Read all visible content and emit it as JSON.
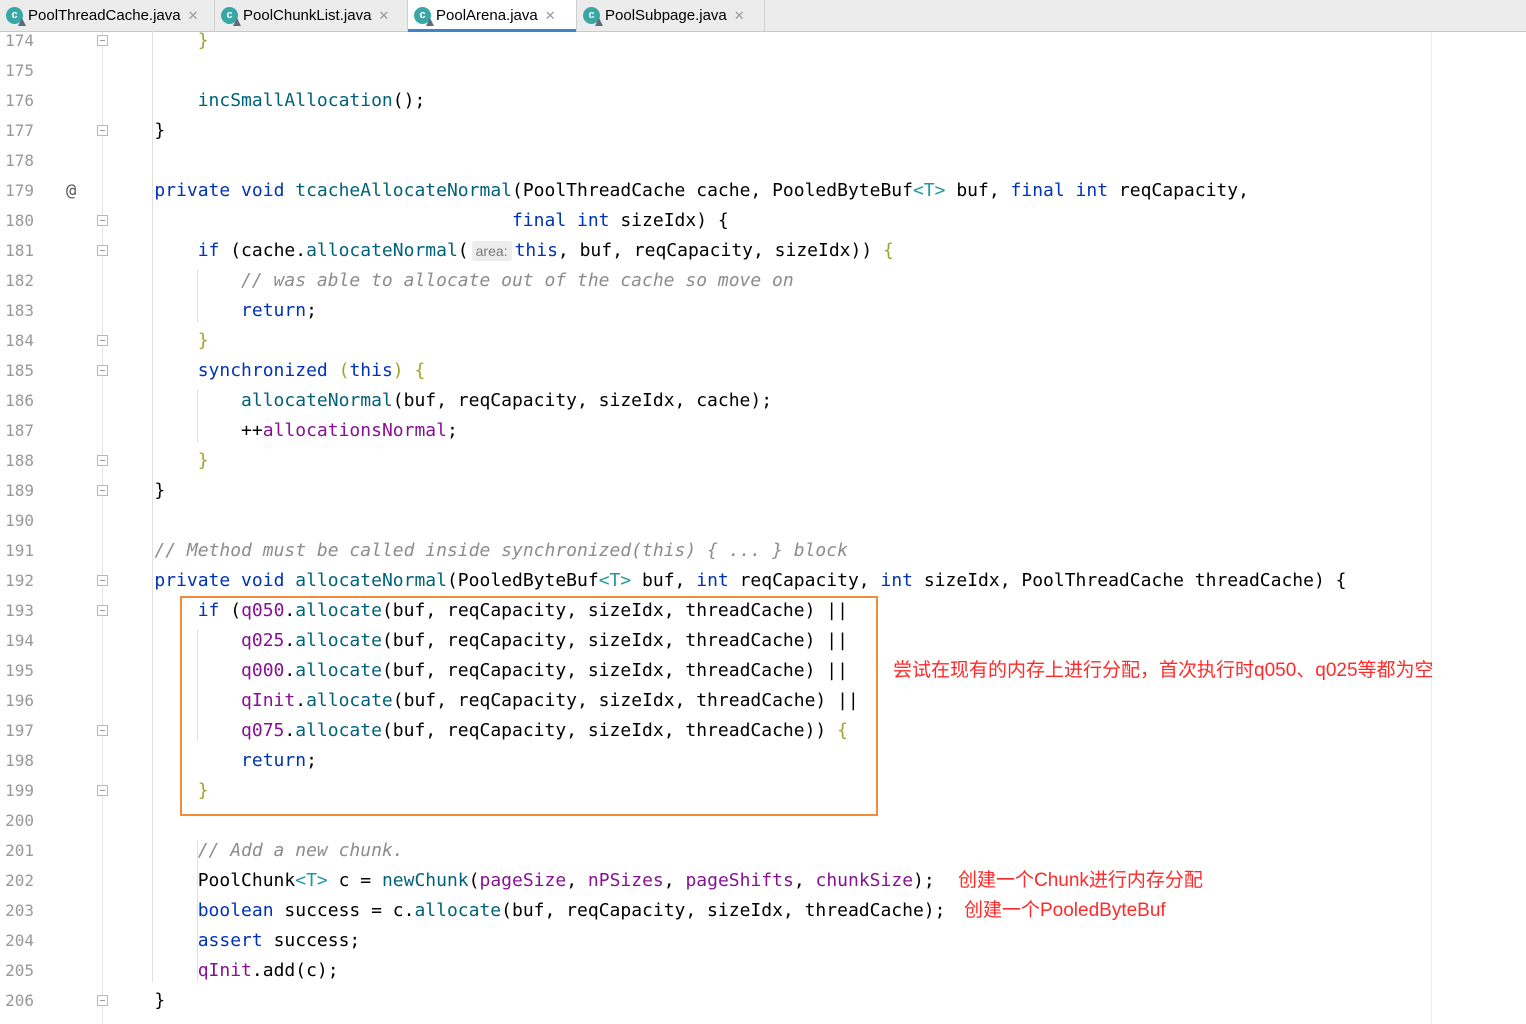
{
  "tabs": [
    {
      "label": "PoolThreadCache.java",
      "icon": "java-class-icon",
      "icon_letter": "c",
      "active": false
    },
    {
      "label": "PoolChunkList.java",
      "icon": "java-class-icon",
      "icon_letter": "c",
      "active": false
    },
    {
      "label": "PoolArena.java",
      "icon": "java-class-icon",
      "icon_letter": "c",
      "active": true
    },
    {
      "label": "PoolSubpage.java",
      "icon": "java-class-icon",
      "icon_letter": "c",
      "active": false
    }
  ],
  "tab_close_glyph": "✕",
  "colors": {
    "keyword": "#0033b3",
    "method": "#00627a",
    "field": "#871094",
    "comment": "#8c8c8c",
    "generic": "#20999d",
    "highlight_box": "#f08c3a",
    "annotation": "#ff2a2a",
    "active_tab_underline": "#4083c9"
  },
  "gutter_marker": {
    "line": "179",
    "glyph": "@"
  },
  "lines": [
    {
      "n": "174",
      "fold": "end",
      "indent": 2,
      "t": [
        [
          "}",
          "br1"
        ]
      ]
    },
    {
      "n": "175",
      "t": []
    },
    {
      "n": "176",
      "indent": 2,
      "t": [
        [
          "incSmallAllocation",
          "fn"
        ],
        [
          "();",
          ""
        ]
      ]
    },
    {
      "n": "177",
      "fold": "end",
      "indent": 1,
      "t": [
        [
          "}",
          ""
        ]
      ]
    },
    {
      "n": "178",
      "t": []
    },
    {
      "n": "179",
      "indent": 1,
      "t": [
        [
          "private void ",
          "kw"
        ],
        [
          "tcacheAllocateNormal",
          "fn"
        ],
        [
          "(PoolThreadCache cache, PooledByteBuf",
          ""
        ],
        [
          "<T>",
          "gen"
        ],
        [
          " buf, ",
          ""
        ],
        [
          "final int ",
          "kw"
        ],
        [
          "reqCapacity,",
          ""
        ]
      ]
    },
    {
      "n": "180",
      "fold": "start",
      "t": [
        [
          "                                     ",
          ""
        ],
        [
          "final int ",
          "kw"
        ],
        [
          "sizeIdx) {",
          ""
        ]
      ]
    },
    {
      "n": "181",
      "fold": "start",
      "indent": 2,
      "t": [
        [
          "if ",
          "kw"
        ],
        [
          "(cache.",
          ""
        ],
        [
          "allocateNormal",
          "fn"
        ],
        [
          "(",
          ""
        ],
        [
          "area:",
          "hint"
        ],
        [
          "this",
          "kw"
        ],
        [
          ", buf, reqCapacity, sizeIdx)) ",
          ""
        ],
        [
          "{",
          "br1"
        ]
      ]
    },
    {
      "n": "182",
      "indent": 3,
      "t": [
        [
          "// was able to allocate out of the cache so move on",
          "cm"
        ]
      ]
    },
    {
      "n": "183",
      "indent": 3,
      "t": [
        [
          "return",
          "kw"
        ],
        [
          ";",
          ""
        ]
      ]
    },
    {
      "n": "184",
      "fold": "end",
      "indent": 2,
      "t": [
        [
          "}",
          "br1"
        ]
      ]
    },
    {
      "n": "185",
      "fold": "start",
      "indent": 2,
      "t": [
        [
          "synchronized ",
          "kw"
        ],
        [
          "(",
          "br1"
        ],
        [
          "this",
          "kw"
        ],
        [
          ") ",
          "br1"
        ],
        [
          "{",
          "br1"
        ]
      ]
    },
    {
      "n": "186",
      "indent": 3,
      "t": [
        [
          "allocateNormal",
          "fn"
        ],
        [
          "(buf, reqCapacity, sizeIdx, cache);",
          ""
        ]
      ]
    },
    {
      "n": "187",
      "indent": 3,
      "t": [
        [
          "++",
          ""
        ],
        [
          "allocationsNormal",
          "fld"
        ],
        [
          ";",
          ""
        ]
      ]
    },
    {
      "n": "188",
      "fold": "end",
      "indent": 2,
      "t": [
        [
          "}",
          "br1"
        ]
      ]
    },
    {
      "n": "189",
      "fold": "end",
      "indent": 1,
      "t": [
        [
          "}",
          ""
        ]
      ]
    },
    {
      "n": "190",
      "t": []
    },
    {
      "n": "191",
      "indent": 1,
      "t": [
        [
          "// Method must be called inside synchronized(this) { ... } block",
          "cm"
        ]
      ]
    },
    {
      "n": "192",
      "fold": "start",
      "indent": 1,
      "t": [
        [
          "private void ",
          "kw"
        ],
        [
          "allocateNormal",
          "fn"
        ],
        [
          "(PooledByteBuf",
          ""
        ],
        [
          "<T>",
          "gen"
        ],
        [
          " buf, ",
          ""
        ],
        [
          "int ",
          "kw"
        ],
        [
          "reqCapacity, ",
          ""
        ],
        [
          "int ",
          "kw"
        ],
        [
          "sizeIdx, PoolThreadCache threadCache) {",
          ""
        ]
      ]
    },
    {
      "n": "193",
      "fold": "start",
      "indent": 2,
      "t": [
        [
          "if ",
          "kw"
        ],
        [
          "(",
          ""
        ],
        [
          "q050",
          "fld"
        ],
        [
          ".",
          ""
        ],
        [
          "allocate",
          "fn"
        ],
        [
          "(buf, reqCapacity, sizeIdx, threadCache) ||",
          ""
        ]
      ]
    },
    {
      "n": "194",
      "indent": 3,
      "t": [
        [
          "q025",
          "fld"
        ],
        [
          ".",
          ""
        ],
        [
          "allocate",
          "fn"
        ],
        [
          "(buf, reqCapacity, sizeIdx, threadCache) ||",
          ""
        ]
      ]
    },
    {
      "n": "195",
      "indent": 3,
      "t": [
        [
          "q000",
          "fld"
        ],
        [
          ".",
          ""
        ],
        [
          "allocate",
          "fn"
        ],
        [
          "(buf, reqCapacity, sizeIdx, threadCache) ||",
          ""
        ]
      ]
    },
    {
      "n": "196",
      "indent": 3,
      "t": [
        [
          "qInit",
          "fld"
        ],
        [
          ".",
          ""
        ],
        [
          "allocate",
          "fn"
        ],
        [
          "(buf, reqCapacity, sizeIdx, threadCache) ||",
          ""
        ]
      ]
    },
    {
      "n": "197",
      "fold": "start",
      "indent": 3,
      "t": [
        [
          "q075",
          "fld"
        ],
        [
          ".",
          ""
        ],
        [
          "allocate",
          "fn"
        ],
        [
          "(buf, reqCapacity, sizeIdx, threadCache)) ",
          ""
        ],
        [
          "{",
          "br1"
        ]
      ]
    },
    {
      "n": "198",
      "indent": 3,
      "t": [
        [
          "return",
          "kw"
        ],
        [
          ";",
          ""
        ]
      ]
    },
    {
      "n": "199",
      "fold": "end",
      "indent": 2,
      "t": [
        [
          "}",
          "br1"
        ]
      ]
    },
    {
      "n": "200",
      "t": []
    },
    {
      "n": "201",
      "indent": 2,
      "t": [
        [
          "// Add a new chunk.",
          "cm"
        ]
      ]
    },
    {
      "n": "202",
      "indent": 2,
      "t": [
        [
          "PoolChunk",
          ""
        ],
        [
          "<T>",
          "gen"
        ],
        [
          " c = ",
          ""
        ],
        [
          "newChunk",
          "fn"
        ],
        [
          "(",
          ""
        ],
        [
          "pageSize",
          "fld"
        ],
        [
          ", ",
          ""
        ],
        [
          "nPSizes",
          "fld"
        ],
        [
          ", ",
          ""
        ],
        [
          "pageShifts",
          "fld"
        ],
        [
          ", ",
          ""
        ],
        [
          "chunkSize",
          "fld"
        ],
        [
          ");",
          ""
        ]
      ]
    },
    {
      "n": "203",
      "indent": 2,
      "t": [
        [
          "boolean ",
          "kw"
        ],
        [
          "success = c.",
          ""
        ],
        [
          "allocate",
          "fn"
        ],
        [
          "(buf, reqCapacity, sizeIdx, threadCache);",
          ""
        ]
      ]
    },
    {
      "n": "204",
      "indent": 2,
      "t": [
        [
          "assert ",
          "kw"
        ],
        [
          "success;",
          ""
        ]
      ]
    },
    {
      "n": "205",
      "indent": 2,
      "t": [
        [
          "qInit",
          "fld"
        ],
        [
          ".add(c);",
          ""
        ]
      ]
    },
    {
      "n": "206",
      "fold": "end",
      "indent": 1,
      "t": [
        [
          "}",
          ""
        ]
      ]
    }
  ],
  "annotations": [
    {
      "id": "annotation-try-existing",
      "text": "尝试在现有的内存上进行分配，首次执行时q050、q025等都为空",
      "line": "195"
    },
    {
      "id": "annotation-create-chunk",
      "text": "创建一个Chunk进行内存分配",
      "line": "202"
    },
    {
      "id": "annotation-create-buf",
      "text": "创建一个PooledByteBuf",
      "line": "203"
    }
  ]
}
